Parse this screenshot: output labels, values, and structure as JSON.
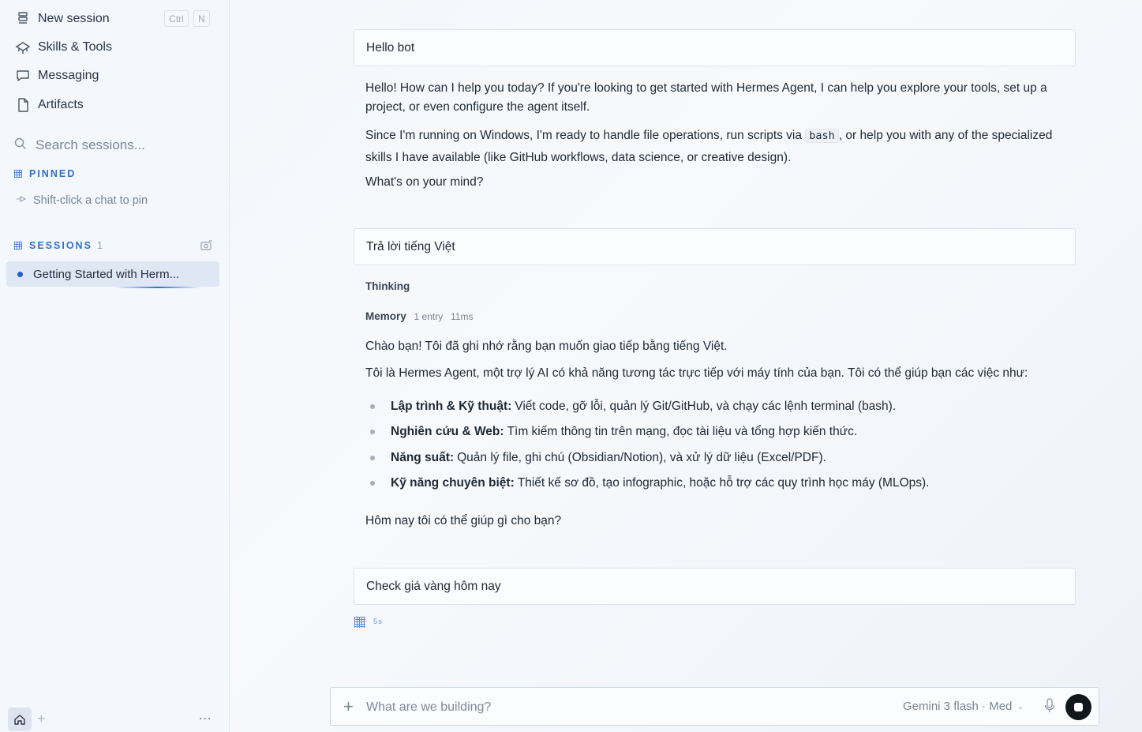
{
  "sidebar": {
    "nav": [
      {
        "label": "New session",
        "icon": "new-session-icon"
      },
      {
        "label": "Skills & Tools",
        "icon": "skills-tools-icon"
      },
      {
        "label": "Messaging",
        "icon": "messaging-icon"
      },
      {
        "label": "Artifacts",
        "icon": "artifacts-icon"
      }
    ],
    "shortcut": {
      "key1": "Ctrl",
      "key2": "N"
    },
    "search_placeholder": "Search sessions...",
    "pinned_label": "PINNED",
    "pin_hint": "Shift-click a chat to pin",
    "sessions_label": "SESSIONS",
    "sessions_count": "1",
    "sessions": [
      {
        "title": "Getting Started with Herm..."
      }
    ],
    "footer": {
      "more": "..."
    }
  },
  "conversation": {
    "msg1_user": "Hello bot",
    "msg1_reply_p1": "Hello! How can I help you today? If you're looking to get started with Hermes Agent, I can help you explore your tools, set up a project, or even configure the agent itself.",
    "msg1_reply_p2_a": "Since I'm running on Windows, I'm ready to handle file operations, run scripts via ",
    "msg1_reply_p2_code": "bash",
    "msg1_reply_p2_b": ", or help you with any of the specialized skills I have available (like GitHub workflows, data science, or creative design).",
    "msg1_reply_p3": "What's on your mind?",
    "msg2_user": "Trả lời tiếng Việt",
    "thinking_label": "Thinking",
    "memory_label": "Memory",
    "memory_entries": "1 entry",
    "memory_time": "11ms",
    "msg2_reply_p1": "Chào bạn! Tôi đã ghi nhớ rằng bạn muốn giao tiếp bằng tiếng Việt.",
    "msg2_reply_p2": "Tôi là Hermes Agent, một trợ lý AI có khả năng tương tác trực tiếp với máy tính của bạn. Tôi có thể giúp bạn các việc như:",
    "bullets": [
      {
        "bold": "Lập trình & Kỹ thuật:",
        "text": "Viết code, gỡ lỗi, quản lý Git/GitHub, và chạy các lệnh terminal (bash)."
      },
      {
        "bold": "Nghiên cứu & Web:",
        "text": "Tìm kiếm thông tin trên mạng, đọc tài liệu và tổng hợp kiến thức."
      },
      {
        "bold": "Năng suất:",
        "text": "Quản lý file, ghi chú (Obsidian/Notion), và xử lý dữ liệu (Excel/PDF)."
      },
      {
        "bold": "Kỹ năng chuyên biệt:",
        "text": "Thiết kế sơ đồ, tạo infographic, hoặc hỗ trợ các quy trình học máy (MLOps)."
      }
    ],
    "msg2_reply_p3": "Hôm nay tôi có thể giúp gì cho bạn?",
    "msg3_user": "Check giá vàng hôm nay",
    "typing_time": "5s"
  },
  "composer": {
    "placeholder": "What are we building?",
    "model": "Gemini 3 flash · Med"
  },
  "colors": {
    "accent": "#2f6fd6",
    "selected_session_bg": "#dfe6f4",
    "stop_button": "#11151c"
  }
}
